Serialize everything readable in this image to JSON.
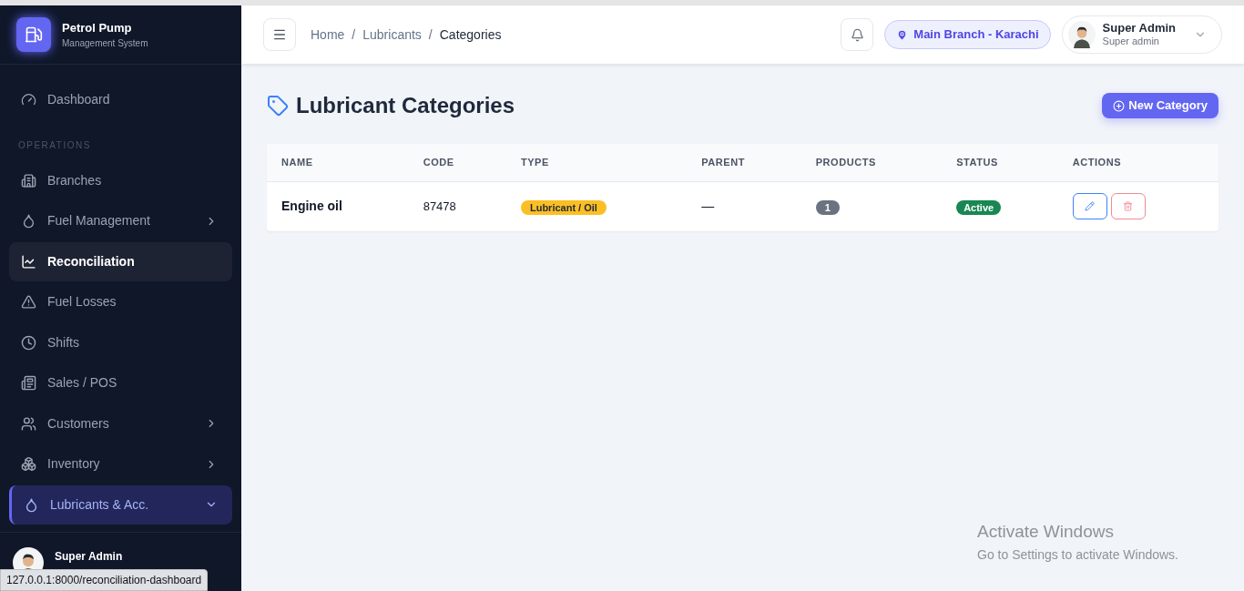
{
  "brand": {
    "title": "Petrol Pump",
    "subtitle": "Management System"
  },
  "sidebar": {
    "items": [
      {
        "kind": "link",
        "label": "Dashboard",
        "selected": false,
        "hovered": false
      },
      {
        "kind": "section",
        "label": "OPERATIONS"
      },
      {
        "kind": "link",
        "label": "Branches",
        "selected": false,
        "hovered": false
      },
      {
        "kind": "group",
        "label": "Fuel Management",
        "selected": false,
        "hovered": false,
        "expanded": false
      },
      {
        "kind": "link",
        "label": "Reconciliation",
        "selected": false,
        "hovered": true
      },
      {
        "kind": "link",
        "label": "Fuel Losses",
        "selected": false,
        "hovered": false
      },
      {
        "kind": "link",
        "label": "Shifts",
        "selected": false,
        "hovered": false
      },
      {
        "kind": "link",
        "label": "Sales / POS",
        "selected": false,
        "hovered": false
      },
      {
        "kind": "group",
        "label": "Customers",
        "selected": false,
        "hovered": false,
        "expanded": false
      },
      {
        "kind": "group",
        "label": "Inventory",
        "selected": false,
        "hovered": false,
        "expanded": false
      },
      {
        "kind": "group",
        "label": "Lubricants & Acc.",
        "selected": true,
        "hovered": false,
        "expanded": true
      }
    ],
    "user": {
      "name": "Super Admin"
    }
  },
  "status_url": "127.0.0.1:8000/reconciliation-dashboard",
  "breadcrumb": [
    "Home",
    "Lubricants",
    "Categories"
  ],
  "breadcrumb_separators": [
    "/",
    "/"
  ],
  "branch": "Main Branch - Karachi",
  "user": {
    "name": "Super Admin",
    "role": "Super admin"
  },
  "page_title": "Lubricant Categories",
  "new_button": "New Category",
  "table": {
    "columns": [
      "NAME",
      "CODE",
      "TYPE",
      "PARENT",
      "PRODUCTS",
      "STATUS",
      "ACTIONS"
    ],
    "rows": [
      {
        "name": "Engine oil",
        "code": "87478",
        "type": "Lubricant / Oil",
        "parent": "—",
        "products": "1",
        "status": "Active",
        "active": true
      }
    ]
  },
  "os_notice": {
    "title": "Activate Windows",
    "text": "Go to Settings to activate Windows."
  }
}
